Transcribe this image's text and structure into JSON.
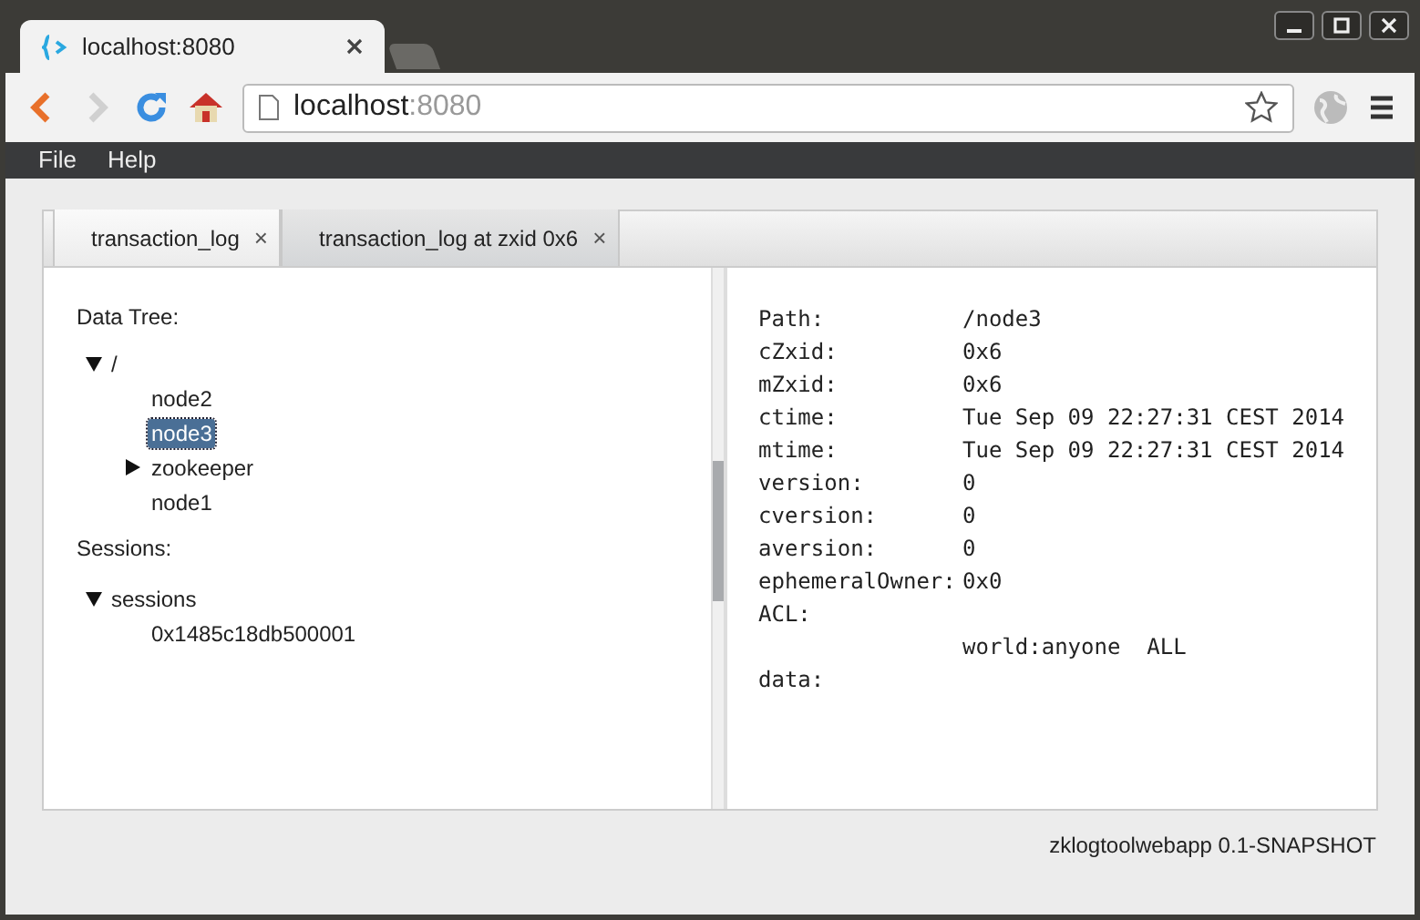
{
  "browser": {
    "tab": {
      "title": "localhost:8080"
    },
    "url": {
      "host": "localhost",
      "port": ":8080"
    }
  },
  "menu": [
    "File",
    "Help"
  ],
  "tabs": [
    {
      "label": "transaction_log",
      "close": "×",
      "selected": false
    },
    {
      "label": "transaction_log at zxid 0x6",
      "close": "×",
      "selected": true
    }
  ],
  "data_tree": {
    "heading": "Data Tree:",
    "items": [
      {
        "label": "/",
        "expanded": true,
        "selected": false,
        "children": [
          {
            "label": "node2",
            "selected": false
          },
          {
            "label": "node3",
            "selected": true
          },
          {
            "label": "zookeeper",
            "expanded": false,
            "selected": false
          },
          {
            "label": "node1",
            "selected": false
          }
        ]
      }
    ]
  },
  "sessions": {
    "heading": "Sessions:",
    "items": [
      {
        "label": "sessions",
        "expanded": true,
        "selected": false,
        "children": [
          {
            "label": "0x1485c18db500001",
            "selected": false
          }
        ]
      }
    ]
  },
  "details": [
    {
      "label": "Path:",
      "value": "/node3"
    },
    {
      "label": "cZxid:",
      "value": "0x6"
    },
    {
      "label": "mZxid:",
      "value": "0x6"
    },
    {
      "label": "ctime:",
      "value": "Tue Sep 09 22:27:31 CEST 2014"
    },
    {
      "label": "mtime:",
      "value": "Tue Sep 09 22:27:31 CEST 2014"
    },
    {
      "label": "version:",
      "value": "0"
    },
    {
      "label": "cversion:",
      "value": "0"
    },
    {
      "label": "aversion:",
      "value": "0"
    },
    {
      "label": "ephemeralOwner:",
      "value": "0x0"
    },
    {
      "label": "ACL:"
    },
    {
      "value": "world:anyone  ALL"
    },
    {
      "label": "data:"
    }
  ],
  "footer": "zklogtoolwebapp 0.1-SNAPSHOT"
}
